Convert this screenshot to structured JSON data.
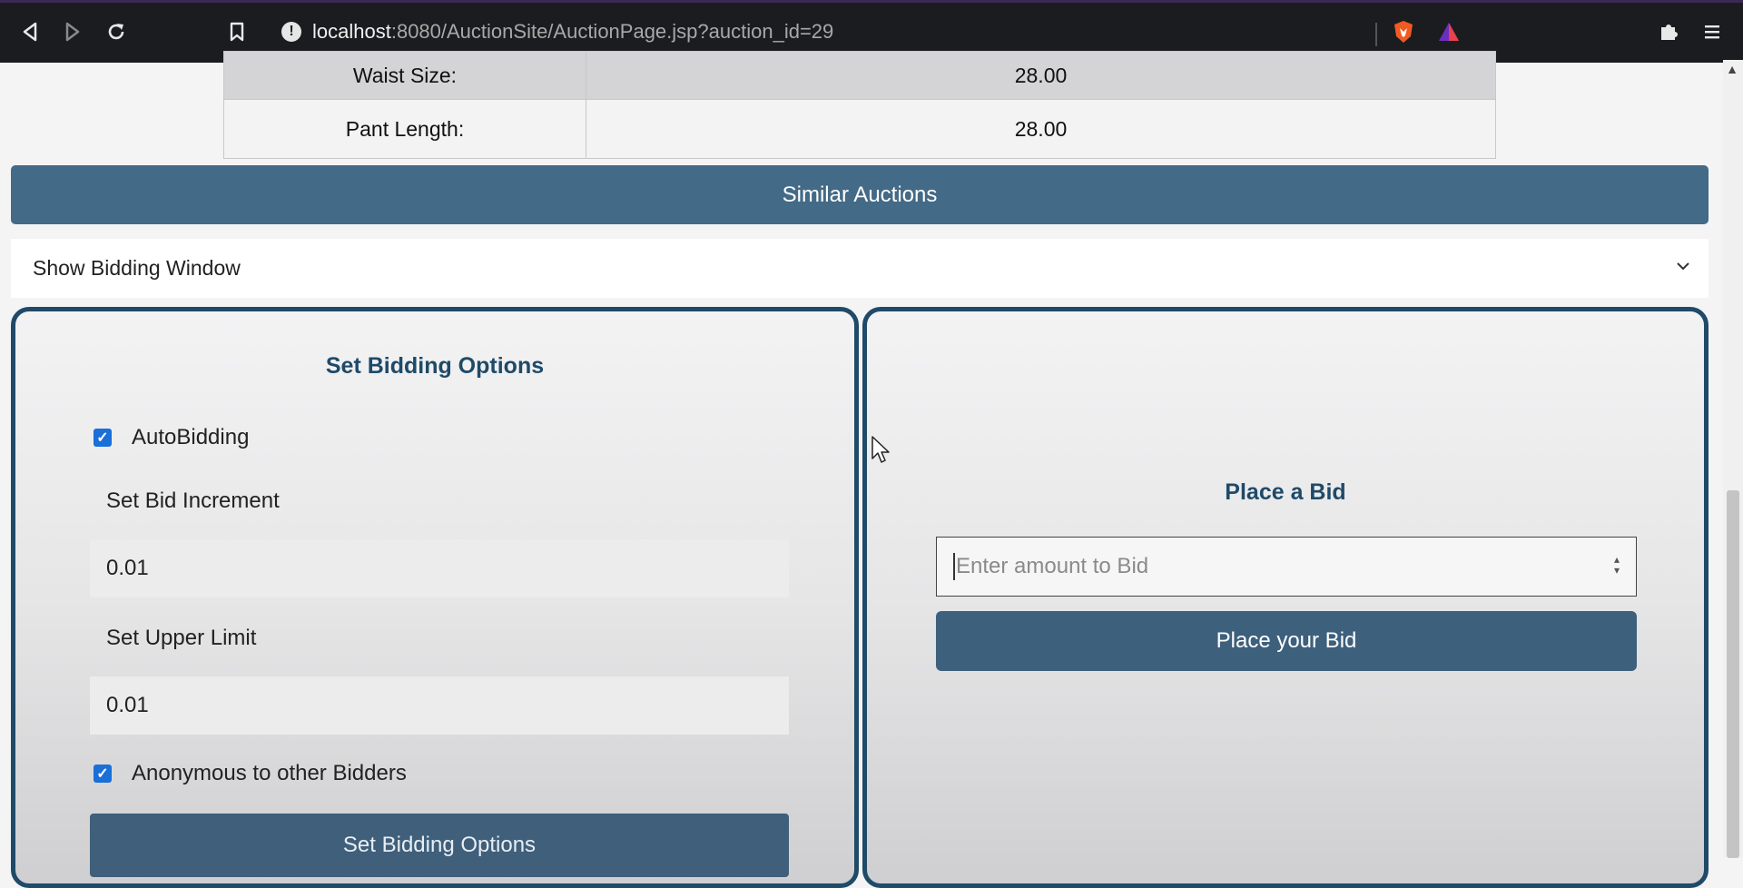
{
  "browser": {
    "url_host": "localhost",
    "url_path": ":8080/AuctionSite/AuctionPage.jsp?auction_id=29",
    "icons": [
      "back-icon",
      "forward-icon",
      "reload-icon",
      "bookmark-icon",
      "info-icon",
      "brave-shield-icon",
      "brave-rewards-icon",
      "extensions-icon",
      "menu-icon"
    ]
  },
  "specs": [
    {
      "label": "Waist Size:",
      "value": "28.00"
    },
    {
      "label": "Pant Length:",
      "value": "28.00"
    }
  ],
  "similar_auctions_label": "Similar Auctions",
  "accordion": {
    "title": "Show Bidding Window"
  },
  "bidding_options": {
    "title": "Set Bidding Options",
    "autobidding_label": "AutoBidding",
    "autobidding_checked": true,
    "increment_label": "Set Bid Increment",
    "increment_value": "0.01",
    "upper_limit_label": "Set Upper Limit",
    "upper_limit_value": "0.01",
    "anonymous_label": "Anonymous to other Bidders",
    "anonymous_checked": true,
    "submit_label": "Set Bidding Options"
  },
  "place_bid": {
    "title": "Place a Bid",
    "input_placeholder": "Enter amount to Bid",
    "submit_label": "Place your Bid"
  },
  "colors": {
    "primary": "#436a86",
    "panel_border": "#1f4a68",
    "checkbox": "#1a6fd8"
  }
}
